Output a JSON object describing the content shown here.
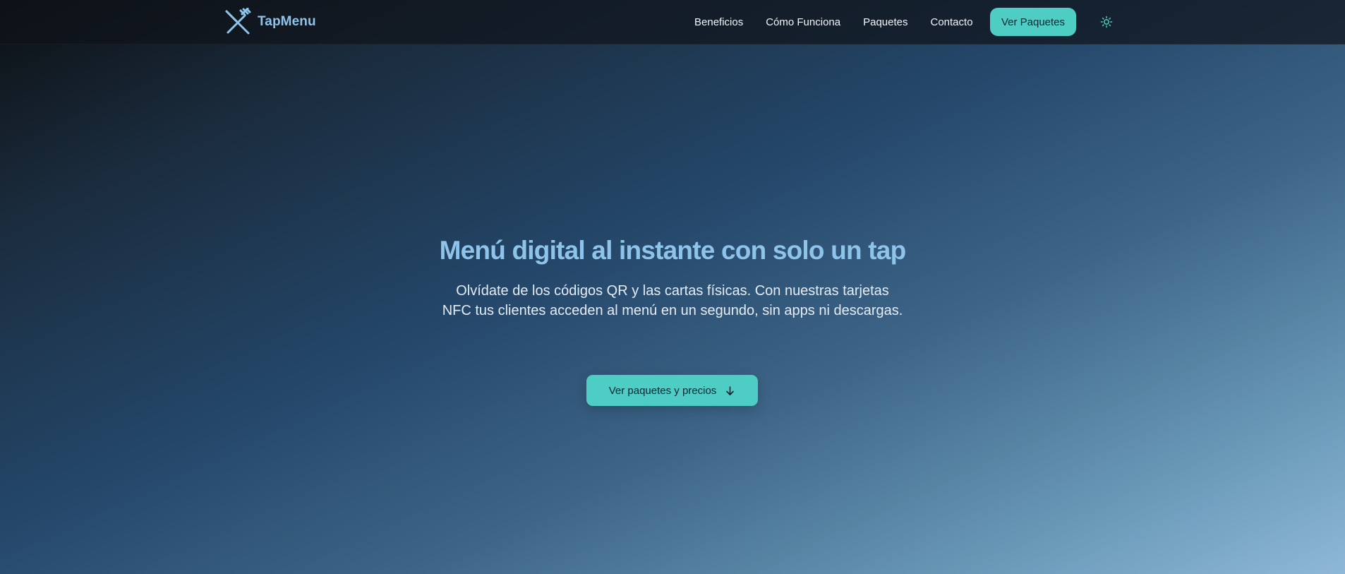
{
  "brand": {
    "name": "TapMenu",
    "icon": "fork-knife-crossed-icon",
    "color": "#8ec3ea"
  },
  "nav": {
    "links": [
      "Beneficios",
      "Cómo Funciona",
      "Paquetes",
      "Contacto"
    ],
    "cta_label": "Ver Paquetes",
    "theme_icon": "sun-icon"
  },
  "hero": {
    "title": "Menú digital al instante con solo un tap",
    "subtitle": "Olvídate de los códigos QR y las cartas físicas. Con nuestras tarjetas NFC tus clientes acceden al menú en un segundo, sin apps ni descargas.",
    "cta_label": "Ver paquetes y precios",
    "cta_icon": "arrow-down-icon"
  },
  "colors": {
    "accent": "#4ecdc4",
    "title": "#8ec3ea",
    "text": "#e5ecf3"
  }
}
